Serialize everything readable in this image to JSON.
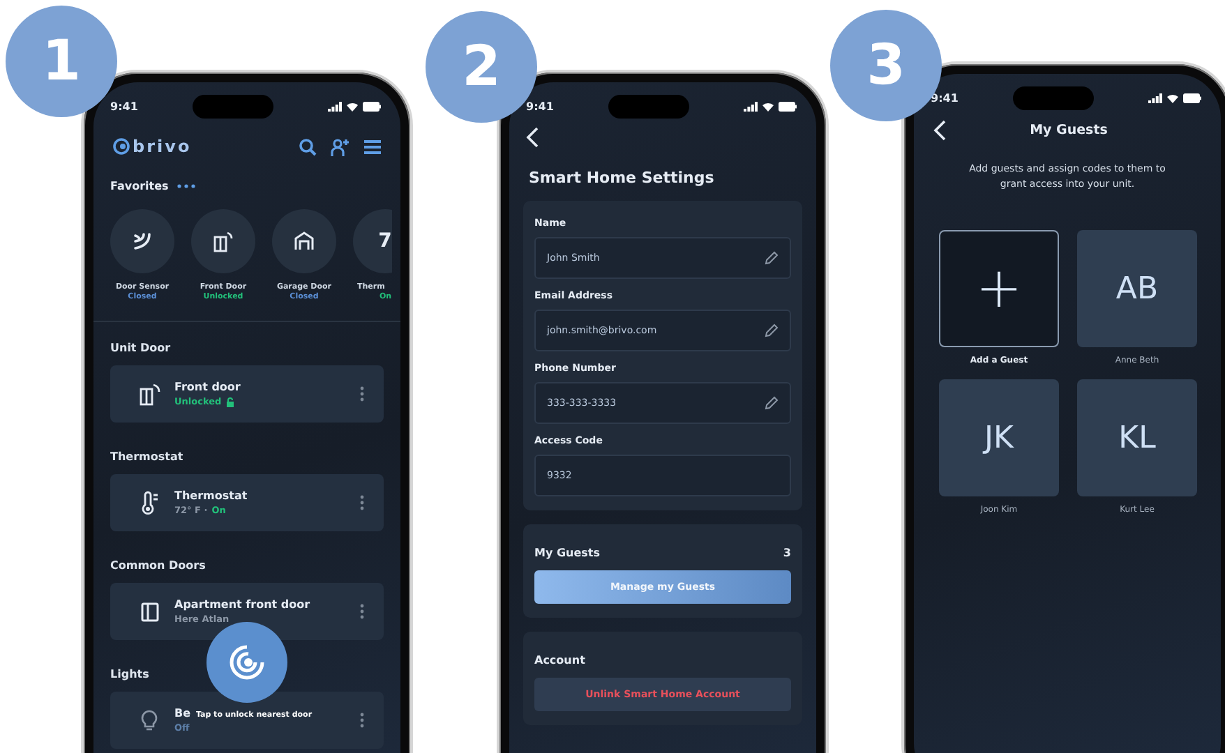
{
  "step_badges": [
    "1",
    "2",
    "3"
  ],
  "home_screen": {
    "time": "9:41",
    "logo": "brivo",
    "favorites_title": "Favorites",
    "favorites": [
      {
        "kind": "sensor",
        "label": "Door Sensor",
        "status": "Closed",
        "color": "#5b8fd6"
      },
      {
        "kind": "door",
        "label": "Front Door",
        "status": "Unlocked",
        "color": "#22c07a"
      },
      {
        "kind": "garage",
        "label": "Garage Door",
        "status": "Closed",
        "color": "#5b8fd6"
      },
      {
        "kind": "reading",
        "reading": "7",
        "label": "Therm",
        "status": "On",
        "color": "#22c07a"
      }
    ],
    "sections": [
      {
        "title": "Unit Door",
        "devices": [
          {
            "kind": "door",
            "name": "Front door",
            "lock_icon": true,
            "status": [
              {
                "text": "Unlocked",
                "color": "#22c07a"
              }
            ]
          }
        ]
      },
      {
        "title": "Thermostat",
        "devices": [
          {
            "kind": "thermostat",
            "name": "Thermostat",
            "lock_icon": false,
            "status": [
              {
                "text": "72° F ·",
                "color": "#8c97a6"
              },
              {
                "text": "On",
                "color": "#22c07a"
              }
            ]
          }
        ]
      },
      {
        "title": "Common Doors",
        "devices": [
          {
            "kind": "apartment",
            "name": "Apartment front door",
            "lock_icon": false,
            "status": [
              {
                "text": "Here Atlan",
                "color": "#8c97a6"
              }
            ]
          }
        ]
      },
      {
        "title": "Lights",
        "devices": [
          {
            "kind": "bulb",
            "name": "Be",
            "lock_icon": false,
            "status": [
              {
                "text": "Off",
                "color": "#5d7fa8"
              }
            ]
          }
        ]
      }
    ],
    "unlock_button": {
      "caption": "Tap to unlock nearest door"
    }
  },
  "settings_screen": {
    "time": "9:41",
    "title": "Smart Home Settings",
    "fields": [
      {
        "label": "Name",
        "value": "John Smith",
        "editable": true
      },
      {
        "label": "Email Address",
        "value": "john.smith@brivo.com",
        "editable": true
      },
      {
        "label": "Phone Number",
        "value": "333-333-3333",
        "editable": true
      },
      {
        "label": "Access Code",
        "value": "9332",
        "editable": false
      }
    ],
    "guests_card": {
      "title": "My Guests",
      "count": "3",
      "button": "Manage my Guests"
    },
    "account_card": {
      "title": "Account",
      "button": "Unlink Smart Home Account"
    }
  },
  "guests_screen": {
    "time": "9:41",
    "title": "My Guests",
    "description": "Add guests and assign codes to them to grant access into your unit.",
    "tiles": [
      {
        "kind": "add",
        "symbol": "+",
        "label": "Add a Guest"
      },
      {
        "kind": "guest",
        "initials": "AB",
        "label": "Anne Beth"
      },
      {
        "kind": "guest",
        "initials": "JK",
        "label": "Joon Kim"
      },
      {
        "kind": "guest",
        "initials": "KL",
        "label": "Kurt Lee"
      }
    ]
  }
}
